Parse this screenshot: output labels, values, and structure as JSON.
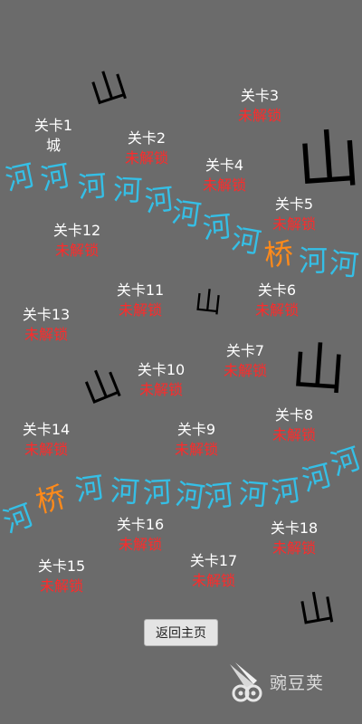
{
  "colors": {
    "background": "#6b6b6b",
    "level_name": "#ffffff",
    "locked_status": "#ff2a2a",
    "river": "#35bfe6",
    "bridge": "#ff8a1a",
    "mountain": "#000000"
  },
  "levels": [
    {
      "id": 1,
      "name": "关卡1",
      "status": "城"
    },
    {
      "id": 2,
      "name": "关卡2",
      "status": "未解锁"
    },
    {
      "id": 3,
      "name": "关卡3",
      "status": "未解锁"
    },
    {
      "id": 4,
      "name": "关卡4",
      "status": "未解锁"
    },
    {
      "id": 5,
      "name": "关卡5",
      "status": "未解锁"
    },
    {
      "id": 6,
      "name": "关卡6",
      "status": "未解锁"
    },
    {
      "id": 7,
      "name": "关卡7",
      "status": "未解锁"
    },
    {
      "id": 8,
      "name": "关卡8",
      "status": "未解锁"
    },
    {
      "id": 9,
      "name": "关卡9",
      "status": "未解锁"
    },
    {
      "id": 10,
      "name": "关卡10",
      "status": "未解锁"
    },
    {
      "id": 11,
      "name": "关卡11",
      "status": "未解锁"
    },
    {
      "id": 12,
      "name": "关卡12",
      "status": "未解锁"
    },
    {
      "id": 13,
      "name": "关卡13",
      "status": "未解锁"
    },
    {
      "id": 14,
      "name": "关卡14",
      "status": "未解锁"
    },
    {
      "id": 15,
      "name": "关卡15",
      "status": "未解锁"
    },
    {
      "id": 16,
      "name": "关卡16",
      "status": "未解锁"
    },
    {
      "id": 17,
      "name": "关卡17",
      "status": "未解锁"
    },
    {
      "id": 18,
      "name": "关卡18",
      "status": "未解锁"
    }
  ],
  "terrain": {
    "mountain": "山",
    "river": "河",
    "bridge": "桥"
  },
  "back_button": {
    "label": "返回主页"
  },
  "watermark": {
    "text": "豌豆荚",
    "icon": "wandoujia-logo-icon"
  }
}
